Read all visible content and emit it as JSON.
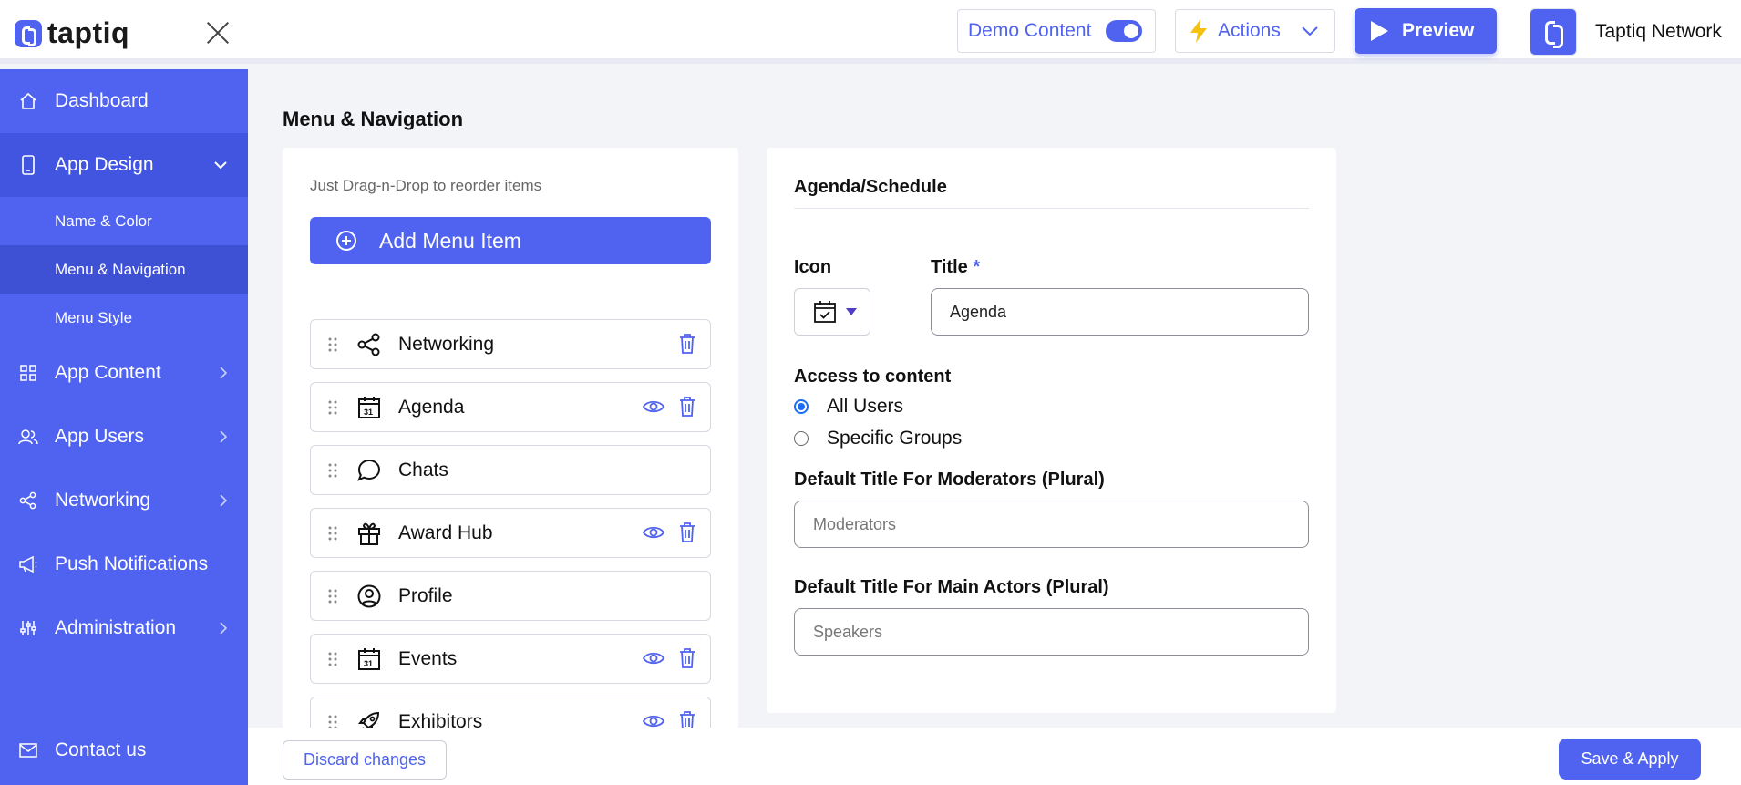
{
  "app": {
    "brand": "taptiq",
    "network_name": "Taptiq Network"
  },
  "header": {
    "demo_label": "Demo Content",
    "demo_enabled": true,
    "actions_label": "Actions",
    "preview_label": "Preview"
  },
  "sidebar": {
    "items": [
      {
        "label": "Dashboard",
        "icon": "home-icon"
      },
      {
        "label": "App Design",
        "icon": "phone-icon",
        "expanded": true
      },
      {
        "label": "App Content",
        "icon": "grid-icon"
      },
      {
        "label": "App Users",
        "icon": "users-icon"
      },
      {
        "label": "Networking",
        "icon": "share-icon"
      },
      {
        "label": "Push Notifications",
        "icon": "megaphone-icon"
      },
      {
        "label": "Administration",
        "icon": "sliders-icon"
      }
    ],
    "subitems": [
      {
        "label": "Name & Color"
      },
      {
        "label": "Menu & Navigation",
        "active": true
      },
      {
        "label": "Menu Style"
      }
    ],
    "contact_label": "Contact us"
  },
  "page": {
    "title": "Menu & Navigation"
  },
  "menu_list": {
    "hint": "Just Drag-n-Drop to reorder items",
    "add_label": "Add Menu Item",
    "items": [
      {
        "label": "Networking",
        "icon": "share-icon",
        "eye": false,
        "trash": true
      },
      {
        "label": "Agenda",
        "icon": "calendar-icon",
        "eye": true,
        "trash": true
      },
      {
        "label": "Chats",
        "icon": "chat-bubble-icon",
        "eye": false,
        "trash": false
      },
      {
        "label": "Award Hub",
        "icon": "gift-icon",
        "eye": true,
        "trash": true
      },
      {
        "label": "Profile",
        "icon": "user-circle-icon",
        "eye": false,
        "trash": false
      },
      {
        "label": "Events",
        "icon": "calendar-icon",
        "eye": true,
        "trash": true
      },
      {
        "label": "Exhibitors",
        "icon": "rocket-icon",
        "eye": true,
        "trash": true
      }
    ]
  },
  "detail": {
    "section_title": "Agenda/Schedule",
    "icon_label": "Icon",
    "title_label": "Title",
    "title_required_mark": "*",
    "title_value": "Agenda",
    "access_label": "Access to content",
    "access_options": [
      {
        "label": "All Users",
        "checked": true
      },
      {
        "label": "Specific Groups",
        "checked": false
      }
    ],
    "moderators_label": "Default Title For Moderators (Plural)",
    "moderators_placeholder": "Moderators",
    "actors_label": "Default Title For Main Actors (Plural)",
    "actors_placeholder": "Speakers"
  },
  "footer": {
    "discard_label": "Discard changes",
    "save_label": "Save & Apply"
  },
  "colors": {
    "accent": "#4f63f0",
    "sidebar_active": "#4255e0",
    "background": "#f3f4f8"
  }
}
